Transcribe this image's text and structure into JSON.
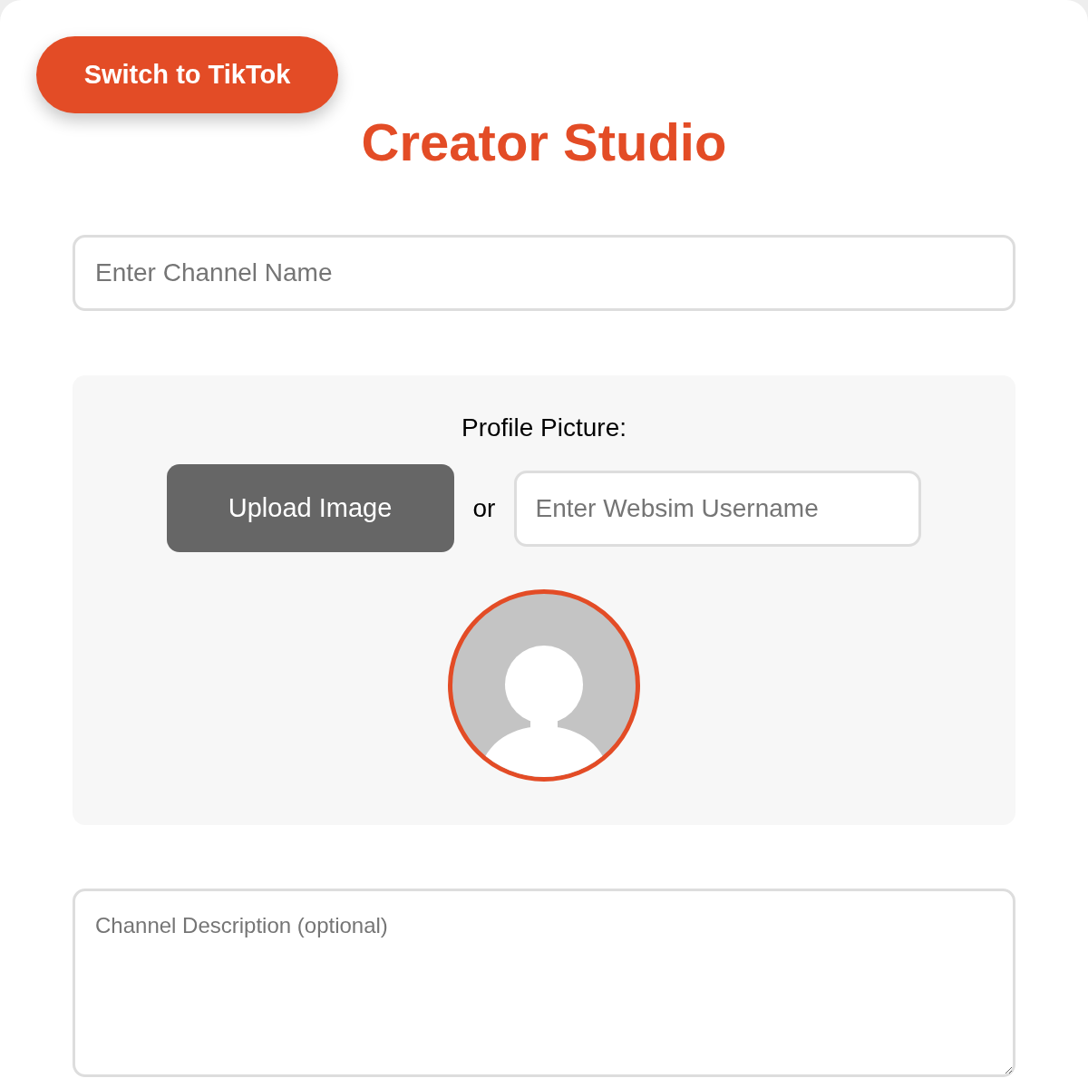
{
  "switch_button": {
    "label": "Switch to TikTok"
  },
  "title": "Creator Studio",
  "channel_name": {
    "placeholder": "Enter Channel Name"
  },
  "profile_picture": {
    "label": "Profile Picture:",
    "upload_button": "Upload Image",
    "separator": "or",
    "username_field": {
      "placeholder": "Enter Websim Username"
    }
  },
  "description": {
    "placeholder": "Channel Description (optional)"
  }
}
